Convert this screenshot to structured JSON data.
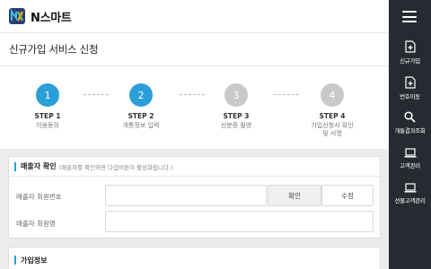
{
  "app": {
    "brand": "N스마트"
  },
  "page": {
    "title": "신규가입 서비스 신청"
  },
  "steps": [
    {
      "number": "1",
      "label": "STEP 1",
      "desc": "이용동의",
      "state": "active"
    },
    {
      "number": "2",
      "label": "STEP 2",
      "desc": "개통정보 입력",
      "state": "active"
    },
    {
      "number": "3",
      "label": "STEP 3",
      "desc": "신분증 촬영",
      "state": "inactive"
    },
    {
      "number": "4",
      "label": "STEP 4",
      "desc": "가입신청서 확인\n및 서명",
      "state": "inactive"
    }
  ],
  "seller_section": {
    "title": "매출자 확인",
    "note": "(매출자를 확인하면 다음버튼이 활성화됩니다.)",
    "member_no_label": "매출자 회원번호",
    "member_no_value": "",
    "member_name_label": "매출자 회원명",
    "member_name_value": "",
    "confirm_button": "확인",
    "edit_button": "수정"
  },
  "join_section": {
    "title": "가입정보"
  },
  "sidebar": {
    "items": [
      {
        "label": "신규가입",
        "icon": "document-plus-icon"
      },
      {
        "label": "번호이동",
        "icon": "document-plus-icon"
      },
      {
        "label": "개통결과조회",
        "icon": "search-icon"
      },
      {
        "label": "고객관리",
        "icon": "laptop-icon"
      },
      {
        "label": "선불고객관리",
        "icon": "laptop-icon"
      }
    ]
  },
  "colors": {
    "accent": "#2a9fd8",
    "sidebar_bg": "#262b31",
    "step_inactive": "#c9c9c9"
  }
}
